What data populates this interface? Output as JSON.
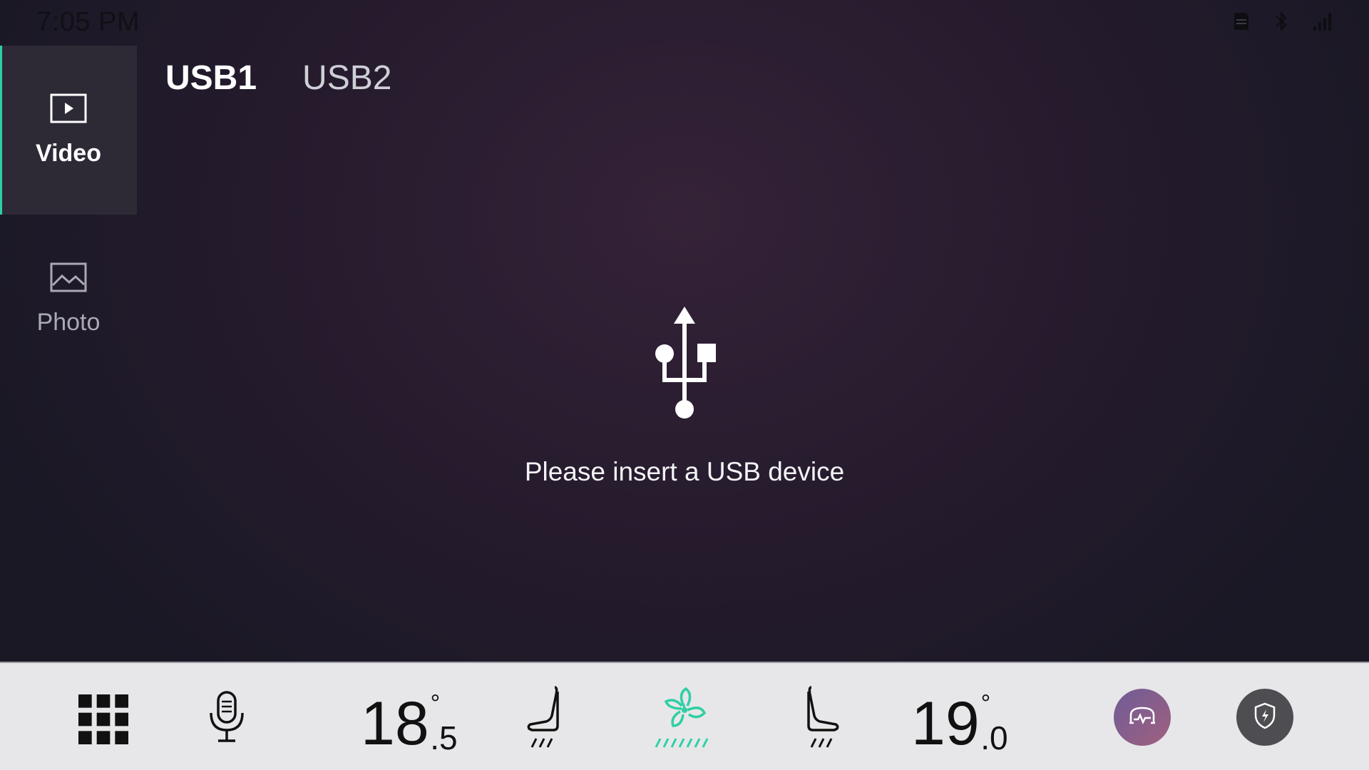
{
  "status": {
    "time": "7:05 PM",
    "icons": [
      "sim-card-icon",
      "bluetooth-icon",
      "cellular-signal-icon"
    ]
  },
  "sidebar": {
    "items": [
      {
        "label": "Video",
        "icon": "video-play-icon",
        "active": true
      },
      {
        "label": "Photo",
        "icon": "image-icon",
        "active": false
      }
    ]
  },
  "tabs": [
    {
      "label": "USB1",
      "active": true
    },
    {
      "label": "USB2",
      "active": false
    }
  ],
  "empty_state": {
    "icon": "usb-icon",
    "message": "Please insert a USB device"
  },
  "climate": {
    "left_temp": {
      "whole": "18",
      "degree": "°",
      "decimal": ".5"
    },
    "right_temp": {
      "whole": "19",
      "degree": "°",
      "decimal": ".0"
    },
    "icons": [
      "app-grid-icon",
      "microphone-icon",
      "seat-heat-left-icon",
      "fan-icon",
      "seat-heat-right-icon",
      "vehicle-status-icon",
      "security-shield-icon"
    ]
  },
  "colors": {
    "accent": "#2fcfa5",
    "bottom_bar": "#e7e7e9"
  }
}
